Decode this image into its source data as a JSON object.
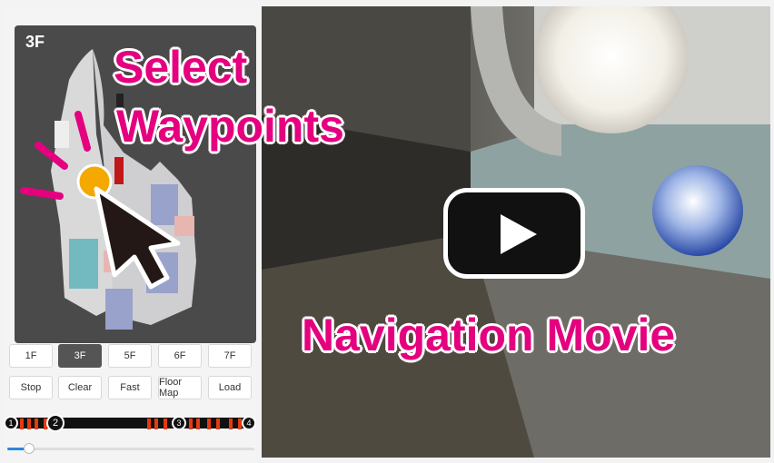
{
  "map": {
    "floor_label": "3F"
  },
  "floor_buttons": [
    "1F",
    "3F",
    "5F",
    "6F",
    "7F"
  ],
  "selected_floor": "3F",
  "control_buttons": [
    "Stop",
    "Clear",
    "Fast",
    "Floor Map",
    "Load"
  ],
  "waypoints": [
    "1",
    "2",
    "3",
    "4"
  ],
  "slider": {
    "progress": 0.09
  },
  "overlay": {
    "select_line1": "Select",
    "select_line2": "Waypoints",
    "navigation_movie": "Navigation Movie"
  },
  "colors": {
    "accent": "#e4007f",
    "cursor_dot": "#f5a800",
    "timeline_marker": "#e63a12",
    "slider": "#2a86e0"
  }
}
